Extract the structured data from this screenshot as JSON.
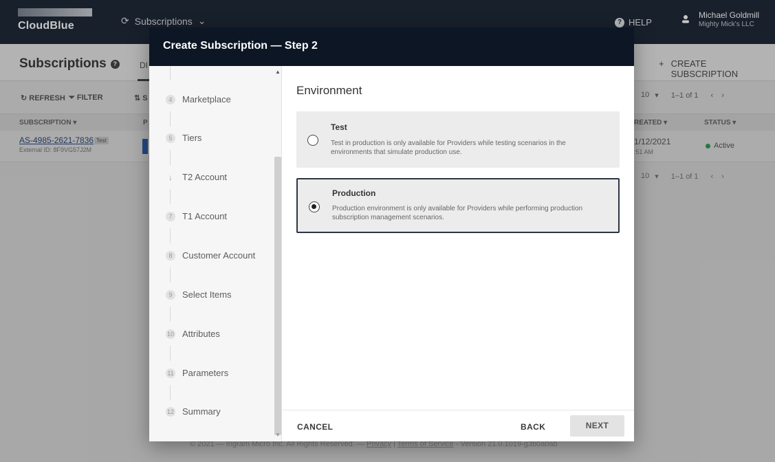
{
  "app": {
    "logo": "CloudBlue",
    "module": "Subscriptions",
    "help": "HELP",
    "user_name": "Michael Goldmill",
    "user_company": "Mighty Mick's LLC"
  },
  "page": {
    "title": "Subscriptions",
    "tab_peek": "DI",
    "create_button": "CREATE SUBSCRIPTION",
    "toolbar": {
      "refresh": "REFRESH",
      "filter": "FILTER",
      "peek": "S"
    },
    "pager": {
      "per_page": "10",
      "range": "1–1 of 1"
    },
    "table": {
      "headers": {
        "subscription": "SUBSCRIPTION",
        "p": "P",
        "created": "REATED",
        "status": "STATUS"
      },
      "row": {
        "id": "AS-4985-2621-7836",
        "badge": "Test",
        "external_id": "External ID: 8F9VG57J2M",
        "date": "1/12/2021",
        "time": ":51 AM",
        "status": "Active"
      }
    },
    "footer": {
      "prefix": "© 2021 — Ingram Micro Inc. All Rights Reserved. — ",
      "privacy": "Privacy",
      "sep": " | ",
      "terms": "Terms of Service",
      "version": " - Version 21.0.1019-g3b0a0ab"
    }
  },
  "dialog": {
    "title": "Create Subscription — Step 2",
    "steps": [
      {
        "num": "4",
        "label": "Marketplace"
      },
      {
        "num": "5",
        "label": "Tiers"
      },
      {
        "num": "↓",
        "label": "T2 Account"
      },
      {
        "num": "7",
        "label": "T1 Account"
      },
      {
        "num": "8",
        "label": "Customer Account"
      },
      {
        "num": "9",
        "label": "Select Items"
      },
      {
        "num": "10",
        "label": "Attributes"
      },
      {
        "num": "11",
        "label": "Parameters"
      },
      {
        "num": "12",
        "label": "Summary"
      }
    ],
    "section_title": "Environment",
    "options": [
      {
        "title": "Test",
        "description": "Test in production is only available for Providers while testing scenarios in the environments that simulate production use.",
        "selected": false
      },
      {
        "title": "Production",
        "description": "Production environment is only available for Providers while performing production subscription management scenarios.",
        "selected": true
      }
    ],
    "buttons": {
      "cancel": "CANCEL",
      "back": "BACK",
      "next": "NEXT"
    }
  },
  "colors": {
    "topbar": "#1f2a38",
    "dialog_header": "#0c1624",
    "status_active": "#2e9c52"
  }
}
